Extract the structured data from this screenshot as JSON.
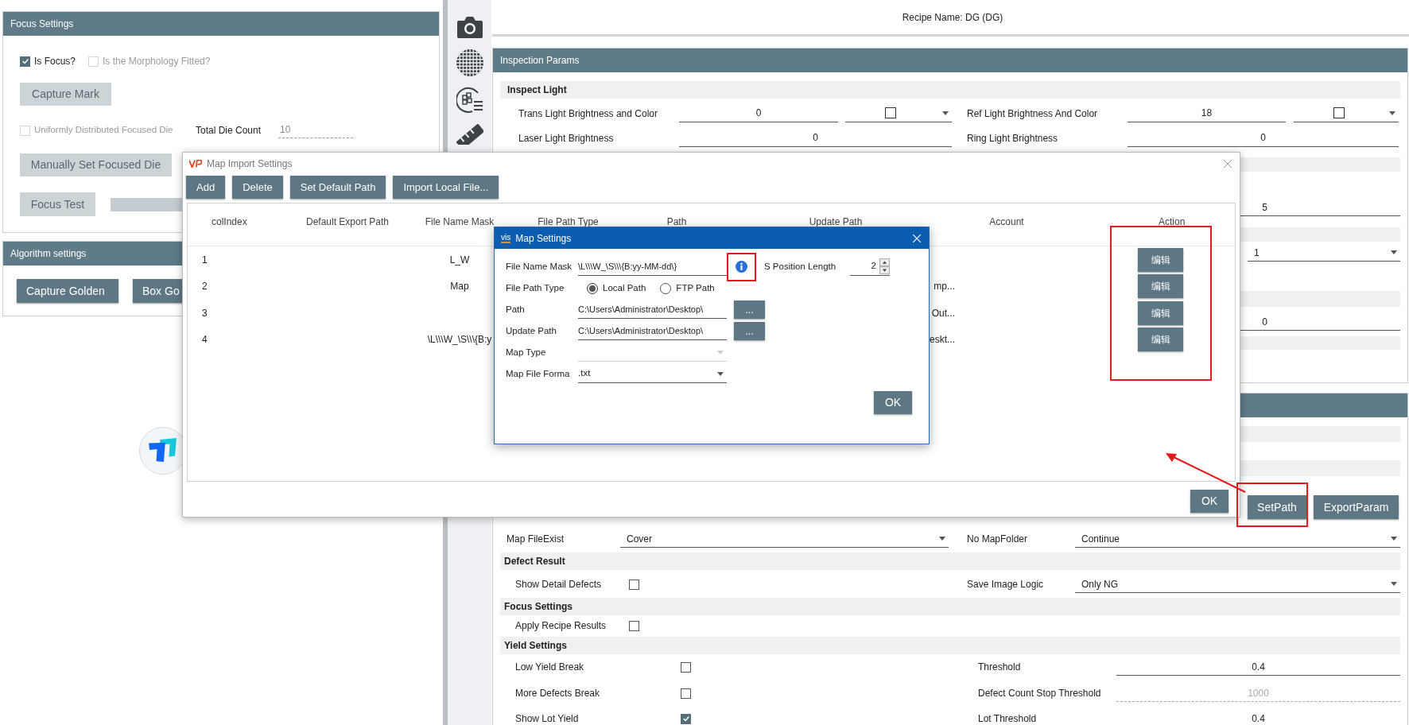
{
  "focus_settings": {
    "title": "Focus Settings",
    "checkboxes": [
      {
        "label": "Is Focus?",
        "checked": true,
        "disabled": false
      },
      {
        "label": "Is the Morphology Fitted?",
        "checked": false,
        "disabled": true
      }
    ],
    "capture_mark": {
      "label": "Capture Mark",
      "disabled": true
    },
    "uniform_die": {
      "label": "Uniformly Distributed Focused Die",
      "checked": false,
      "disabled": true
    },
    "total_die_count": {
      "label": "Total Die Count",
      "value": "10"
    },
    "manual_set": {
      "label": "Manually Set Focused Die",
      "disabled": true
    },
    "focus_test": {
      "label": "Focus Test",
      "disabled": true
    }
  },
  "algorithm_settings": {
    "title": "Algorithm settings",
    "buttons": [
      {
        "label": "Capture Golden"
      },
      {
        "label": "Box Go"
      }
    ]
  },
  "recipe_name": "Recipe Name: DG (DG)",
  "inspection_params": {
    "title": "Inspection Params",
    "section": "Inspect Light",
    "rows": [
      {
        "left": {
          "kind": "color_field",
          "label": "Trans Light Brightness and Color",
          "value": "0"
        },
        "right": {
          "kind": "color_field",
          "label": "Ref Light Brightness And Color",
          "value": "18"
        }
      },
      {
        "left": {
          "kind": "field",
          "label": "Laser Light Brightness",
          "value": "0"
        },
        "right": {
          "kind": "field",
          "label": "Ring Light Brightness",
          "value": "0"
        }
      }
    ],
    "partial_values": [
      {
        "kind": "field",
        "value": "5"
      },
      {
        "kind": "dropdown",
        "value": "1"
      },
      {
        "kind": "field",
        "value": "0"
      }
    ]
  },
  "action_buttons": [
    {
      "label": "SetPath"
    },
    {
      "label": "ExportParam"
    }
  ],
  "output_row": {
    "left": {
      "kind": "dropdown",
      "label": "Map FileExist",
      "value": "Cover"
    },
    "right": {
      "kind": "dropdown",
      "label": "No MapFolder",
      "value": "Continue"
    }
  },
  "sections": [
    {
      "title": "Defect Result",
      "rows": [
        {
          "left": {
            "kind": "checkbox",
            "label": "Show Detail Defects",
            "checked": false
          },
          "right": {
            "kind": "dropdown",
            "label": "Save Image Logic",
            "value": "Only NG"
          }
        }
      ]
    },
    {
      "title": "Focus Settings",
      "rows": [
        {
          "left": {
            "kind": "checkbox",
            "label": "Apply Recipe Results",
            "checked": false
          }
        }
      ]
    }
  ],
  "yield_settings": {
    "title": "Yield Settings",
    "rows": [
      {
        "left": {
          "label": "Low Yield Break",
          "checked": false
        },
        "right": {
          "label": "Threshold",
          "value": "0.4",
          "disabled": false
        }
      },
      {
        "left": {
          "label": "More Defects Break",
          "checked": false
        },
        "right": {
          "label": "Defect Count Stop Threshold",
          "value": "1000",
          "disabled": true
        }
      },
      {
        "left": {
          "label": "Show Lot Yield",
          "checked": true
        },
        "right": {
          "label": "Lot Threshold",
          "value": "0.4",
          "disabled": false
        }
      }
    ]
  },
  "map_import": {
    "title": "Map Import Settings",
    "toolbar": [
      "Add",
      "Delete",
      "Set Default Path",
      "Import Local File..."
    ],
    "columns": [
      "colIndex",
      "Default Export Path",
      "File Name Mask",
      "File Path Type",
      "Path",
      "Update Path",
      "Account",
      "Action"
    ],
    "rows": [
      {
        "index": "1",
        "file_name_mask": "L_W",
        "action": "编辑"
      },
      {
        "index": "2",
        "file_name_mask": "Map",
        "update_path": "mp...",
        "action": "编辑"
      },
      {
        "index": "3",
        "update_path": "Out...",
        "action": "编辑"
      },
      {
        "index": "4",
        "file_name_mask": "\\L\\\\\\W_\\S\\\\\\{B:y",
        "update_path": "eskt...",
        "action": "编辑"
      }
    ],
    "ok": "OK"
  },
  "map_settings": {
    "logo_text": "vis",
    "title": "Map Settings",
    "file_name_mask": {
      "label": "File Name Mask",
      "value": "\\L\\\\\\W_\\S\\\\\\{B:yy-MM-dd\\}"
    },
    "s_position_length": {
      "label": "S Position Length",
      "value": "2"
    },
    "file_path_type": {
      "label": "File Path Type",
      "options": [
        {
          "label": "Local Path",
          "selected": true
        },
        {
          "label": "FTP Path",
          "selected": false
        }
      ]
    },
    "path": {
      "label": "Path",
      "value": "C:\\Users\\Administrator\\Desktop\\",
      "button": "..."
    },
    "update_path": {
      "label": "Update Path",
      "value": "C:\\Users\\Administrator\\Desktop\\",
      "button": "..."
    },
    "map_type": {
      "label": "Map Type",
      "disabled": true
    },
    "map_file_format": {
      "label": "Map File Forma",
      "value": ".txt"
    },
    "ok": "OK"
  }
}
